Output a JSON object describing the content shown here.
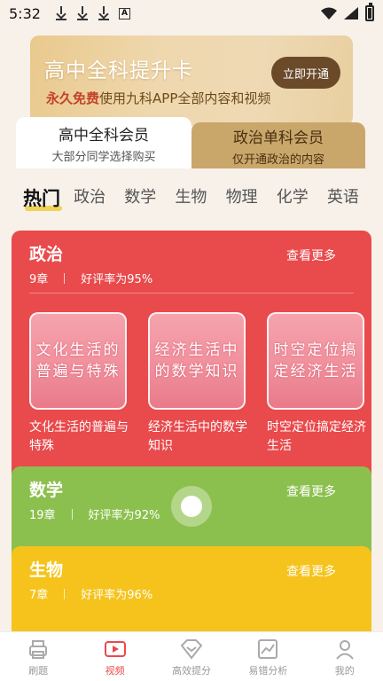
{
  "status_bar": {
    "time": "5:32"
  },
  "banner": {
    "title": "高中全科提升卡",
    "subtitle_highlight": "永久免费",
    "subtitle_rest": "使用九科APP全部内容和视频",
    "cta": "立即开通"
  },
  "member_tabs": [
    {
      "title": "高中全科会员",
      "subtitle": "大部分同学选择购买",
      "active": true
    },
    {
      "title": "政治单科会员",
      "subtitle": "仅开通政治的内容",
      "active": false
    }
  ],
  "subject_tabs": [
    "热门",
    "政治",
    "数学",
    "生物",
    "物理",
    "化学",
    "英语"
  ],
  "cards": {
    "politics": {
      "title": "政治",
      "more": "查看更多",
      "chapters": "9章",
      "rating": "好评率为95%",
      "items": [
        {
          "thumb": "文化生活的普遍与特殊",
          "label": "文化生活的普遍与特殊"
        },
        {
          "thumb": "经济生活中的数学知识",
          "label": "经济生活中的数学知识"
        },
        {
          "thumb": "时空定位搞定经济生活",
          "label": "时空定位搞定经济生活"
        }
      ]
    },
    "math": {
      "title": "数学",
      "more": "查看更多",
      "chapters": "19章",
      "rating": "好评率为92%"
    },
    "bio": {
      "title": "生物",
      "more": "查看更多",
      "chapters": "7章",
      "rating": "好评率为96%"
    }
  },
  "bottom_nav": [
    {
      "label": "刷题",
      "icon": "printer-icon",
      "active": false
    },
    {
      "label": "视频",
      "icon": "video-icon",
      "active": true
    },
    {
      "label": "高效提分",
      "icon": "diamond-icon",
      "active": false
    },
    {
      "label": "易错分析",
      "icon": "chart-icon",
      "active": false
    },
    {
      "label": "我的",
      "icon": "user-icon",
      "active": false
    }
  ],
  "colors": {
    "politics": "#e94a4c",
    "math": "#8cc04e",
    "bio": "#f5c31c",
    "banner_btn": "#6b4a2a"
  }
}
